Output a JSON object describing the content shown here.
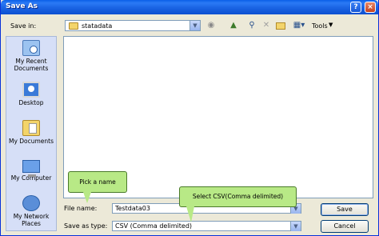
{
  "window": {
    "title": "Save As"
  },
  "titlebar_buttons": {
    "help": "?",
    "close": "×"
  },
  "toolbar": {
    "save_in_label": "Save in:",
    "save_in_value": "statadata",
    "tools_label": "Tools",
    "icons": [
      "back-icon",
      "up-folder-icon",
      "search-web-icon",
      "delete-icon",
      "new-folder-icon",
      "views-icon"
    ]
  },
  "places": [
    {
      "label": "My Recent Documents",
      "icon": "recent-documents-icon"
    },
    {
      "label": "Desktop",
      "icon": "desktop-icon"
    },
    {
      "label": "My Documents",
      "icon": "my-documents-icon"
    },
    {
      "label": "My Computer",
      "icon": "my-computer-icon"
    },
    {
      "label": "My Network Places",
      "icon": "network-places-icon"
    }
  ],
  "form": {
    "file_name_label": "File name:",
    "file_name_value": "Testdata03",
    "save_as_type_label": "Save as type:",
    "save_as_type_value": "CSV (Comma delimited)"
  },
  "buttons": {
    "save": "Save",
    "cancel": "Cancel"
  },
  "callouts": {
    "pick_name": "Pick a name",
    "select_csv": "Select CSV(Comma delimited)"
  },
  "colors": {
    "titlebar": "#0a5fe8",
    "dialog_bg": "#ece9d8",
    "callout_bg": "#b8e986"
  }
}
